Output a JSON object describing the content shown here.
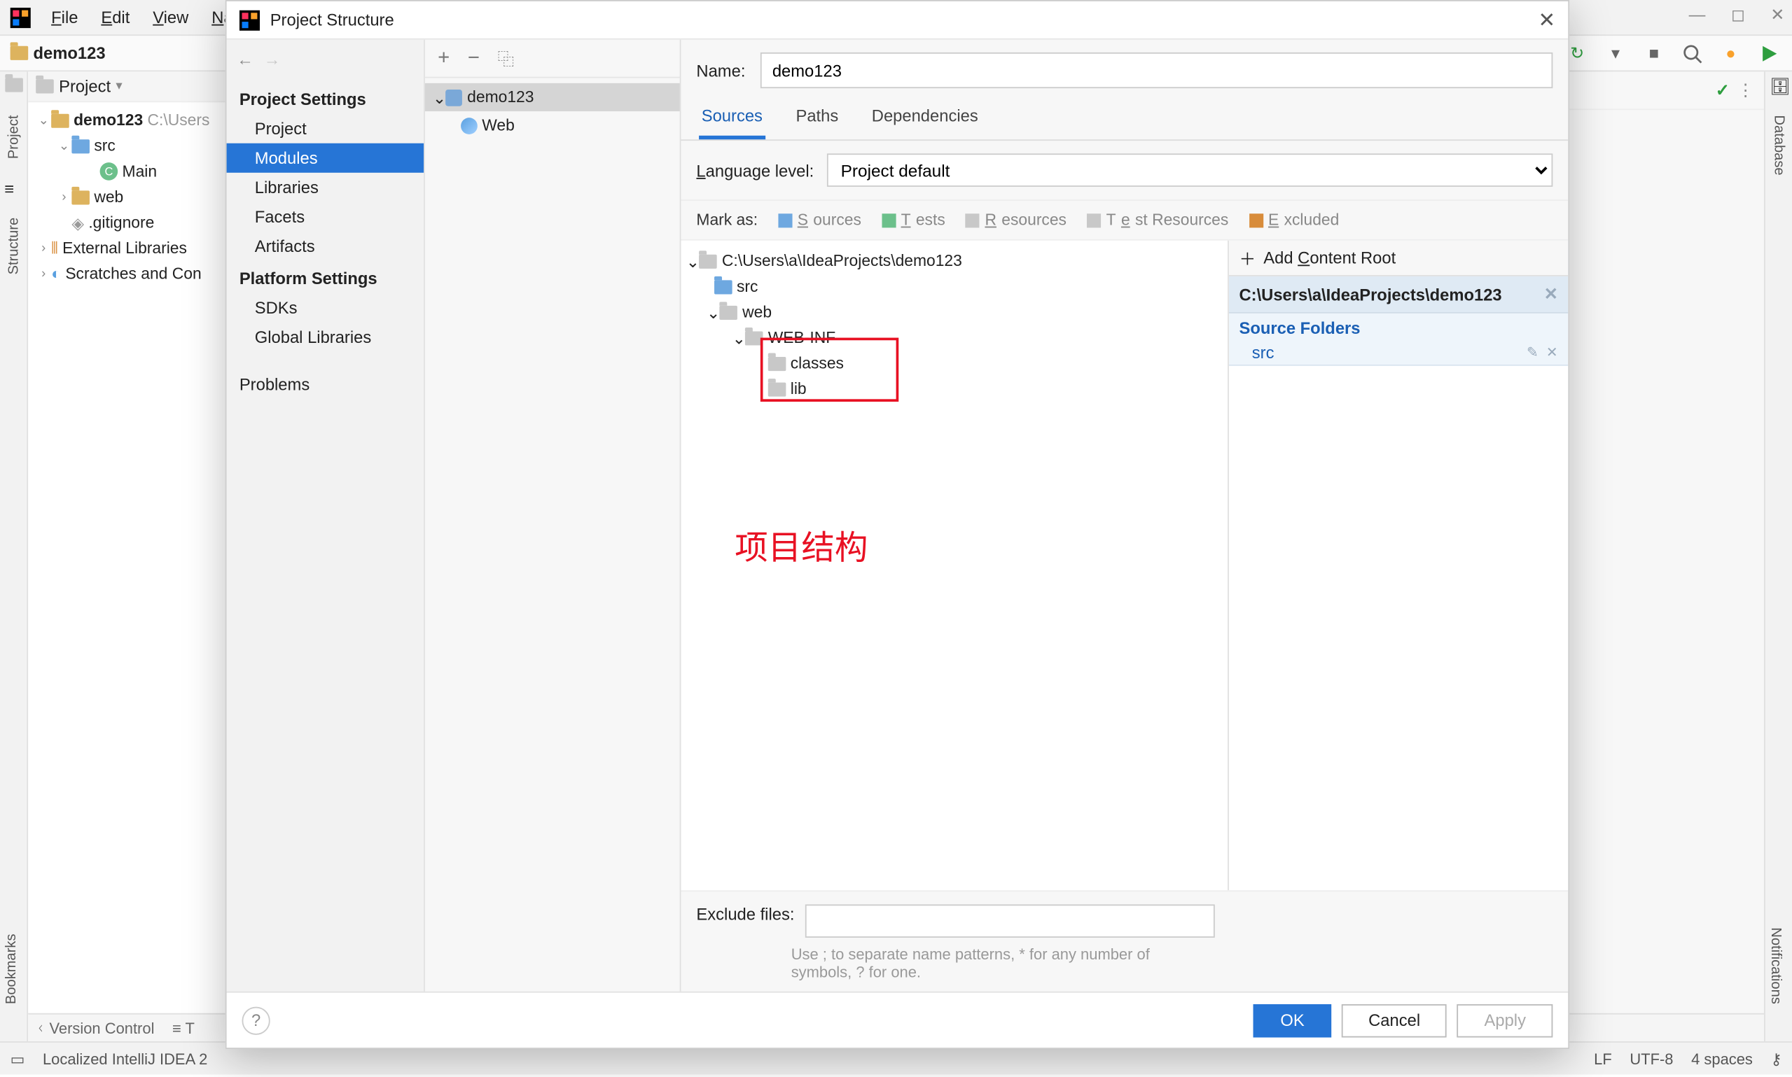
{
  "menu": {
    "file": "File",
    "edit": "Edit",
    "view": "View",
    "navigate": "Nav"
  },
  "breadcrumb": {
    "project": "demo123"
  },
  "window_controls": {
    "min": "—",
    "max": "◻",
    "close": "✕"
  },
  "toolbar_right": {
    "search_hint": "Search",
    "run": "▶"
  },
  "left_rail": {
    "project": "Project",
    "structure": "Structure",
    "bookmarks": "Bookmarks"
  },
  "right_rail": {
    "database": "Database",
    "notifications": "Notifications"
  },
  "project_panel": {
    "title": "Project",
    "root": "demo123",
    "root_path": "C:\\Users",
    "src": "src",
    "main": "Main",
    "web": "web",
    "gitignore": ".gitignore",
    "ext_libs": "External Libraries",
    "scratches": "Scratches and Con"
  },
  "bottom_tabs": {
    "version_control": "Version Control",
    "todo": "T"
  },
  "statusbar": {
    "message": "Localized IntelliJ IDEA 2",
    "lf": "LF",
    "encoding": "UTF-8",
    "indent": "4 spaces"
  },
  "dialog": {
    "title": "Project Structure",
    "nav": {
      "back": "←",
      "forward": "→",
      "section1": "Project Settings",
      "items1": [
        "Project",
        "Modules",
        "Libraries",
        "Facets",
        "Artifacts"
      ],
      "section2": "Platform Settings",
      "items2": [
        "SDKs",
        "Global Libraries"
      ],
      "problems": "Problems"
    },
    "mid": {
      "add": "+",
      "remove": "−",
      "copy": "⿻",
      "module": "demo123",
      "web": "Web"
    },
    "right": {
      "name_label": "Name:",
      "name_value": "demo123",
      "tabs": [
        "Sources",
        "Paths",
        "Dependencies"
      ],
      "lang_label": "Language level:",
      "lang_value": "Project default",
      "mark_label": "Mark as:",
      "marks": [
        "Sources",
        "Tests",
        "Resources",
        "Test Resources",
        "Excluded"
      ],
      "tree_root": "C:\\Users\\a\\IdeaProjects\\demo123",
      "tree_src": "src",
      "tree_web": "web",
      "tree_webinf": "WEB-INF",
      "tree_classes": "classes",
      "tree_lib": "lib",
      "annotation": "项目结构",
      "cr_add": "Add Content Root",
      "cr_path": "C:\\Users\\a\\IdeaProjects\\demo123",
      "cr_section": "Source Folders",
      "cr_src": "src",
      "exclude_label": "Exclude files:",
      "exclude_hint": "Use ; to separate name patterns, * for any number of symbols, ? for one."
    },
    "footer": {
      "ok": "OK",
      "cancel": "Cancel",
      "apply": "Apply",
      "help": "?"
    }
  }
}
